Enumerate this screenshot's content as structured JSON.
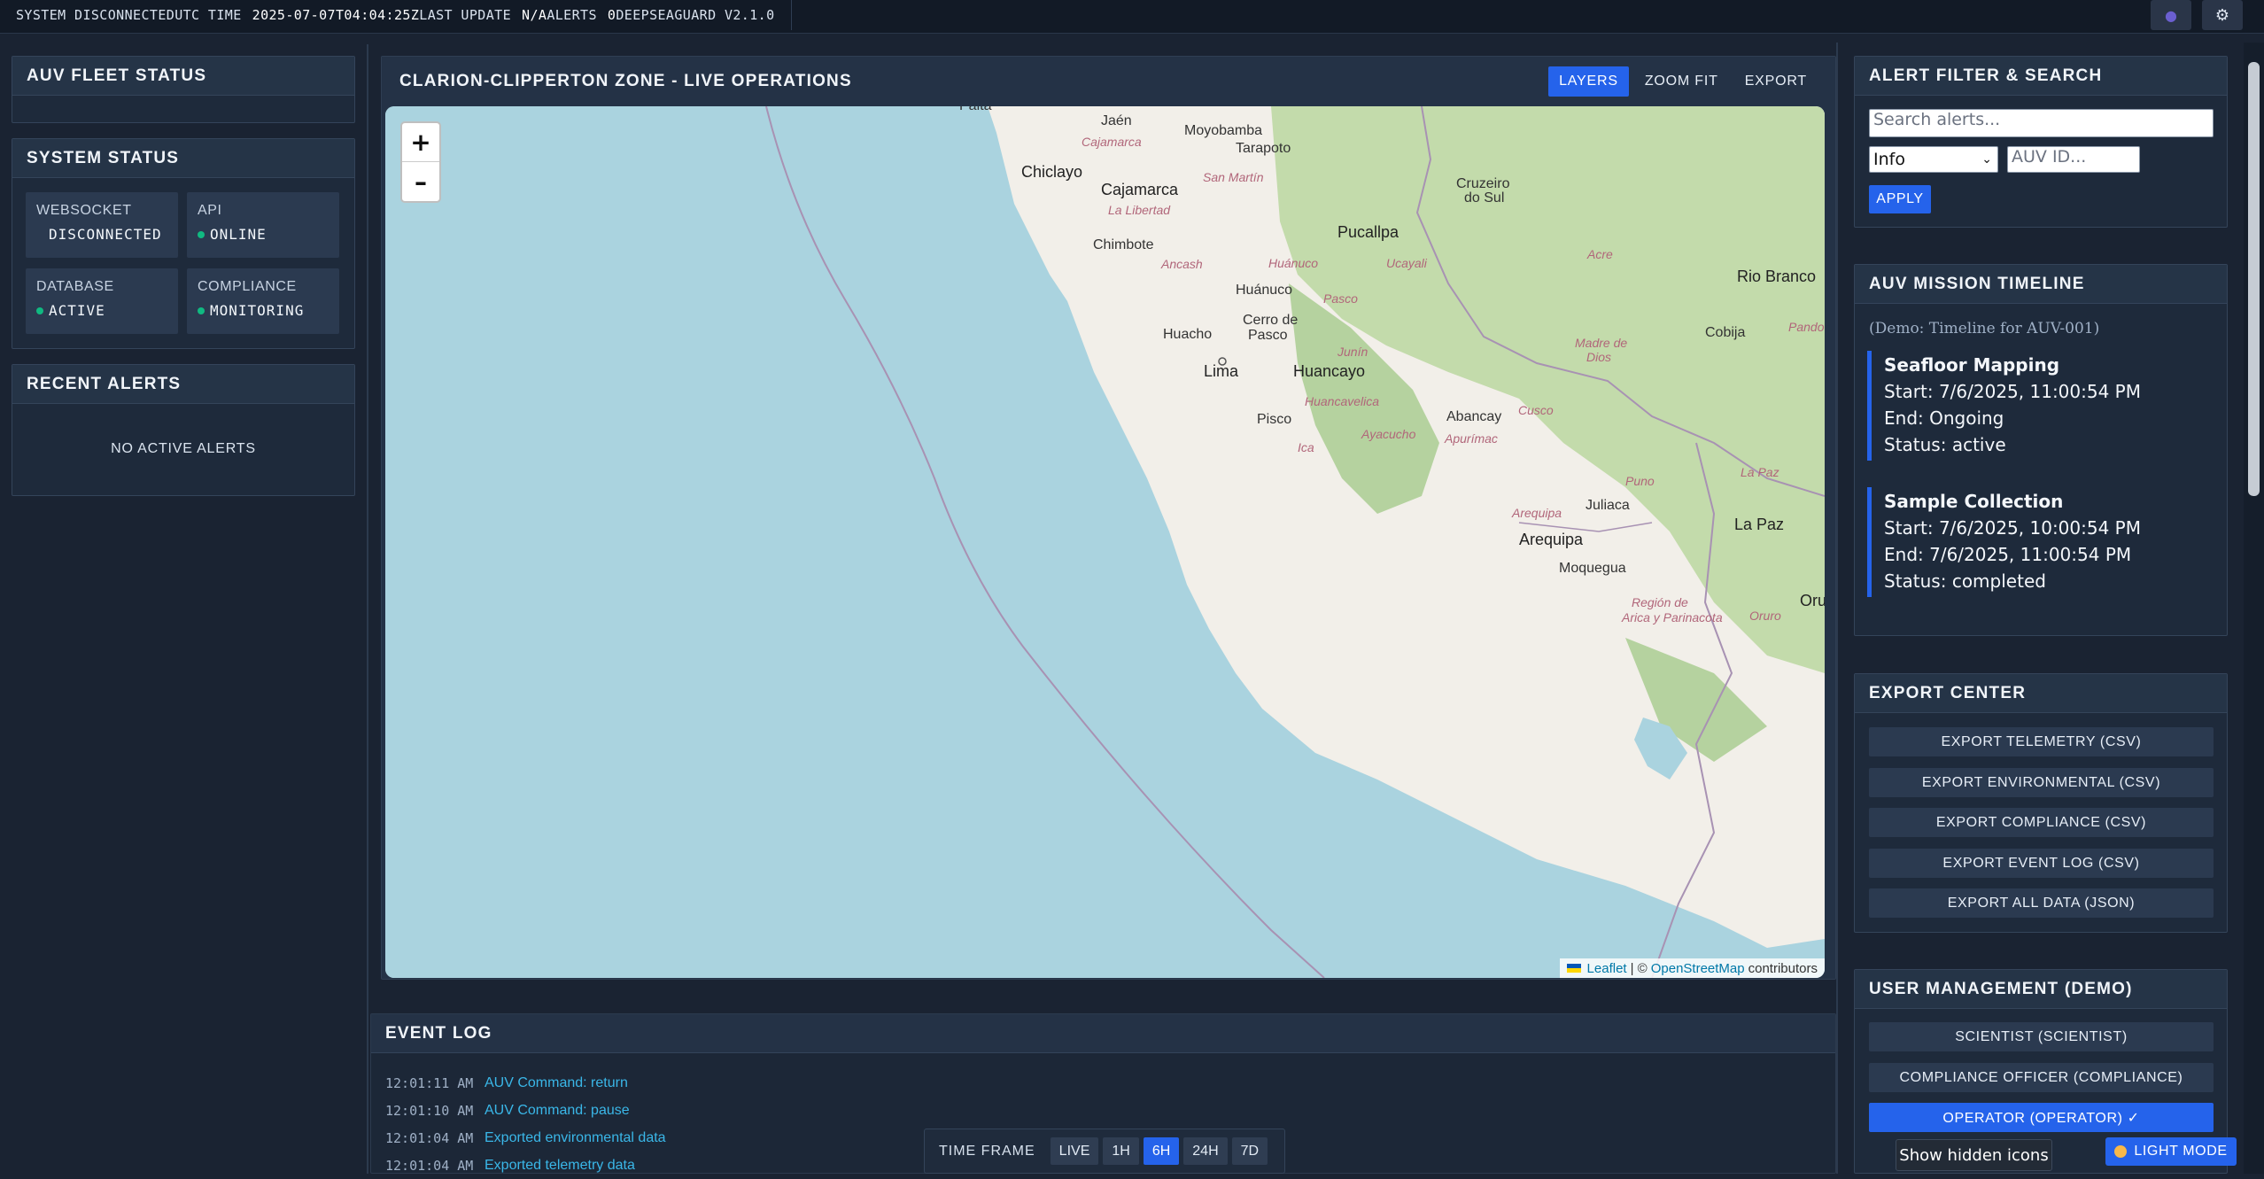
{
  "topbar": {
    "system_status": "SYSTEM DISCONNECTED",
    "utc_label": "UTC TIME",
    "utc_value": "2025-07-07T04:04:25Z",
    "last_update_label": "LAST UPDATE",
    "last_update_value": "N/A",
    "alerts_label": "ALERTS",
    "alerts_value": "0",
    "brand": "DEEPSEAGUARD V2.1.0"
  },
  "left": {
    "fleet_title": "AUV FLEET STATUS",
    "system_title": "SYSTEM STATUS",
    "status": [
      {
        "label": "WEBSOCKET",
        "value": "DISCONNECTED",
        "ok": false
      },
      {
        "label": "API",
        "value": "ONLINE",
        "ok": true
      },
      {
        "label": "DATABASE",
        "value": "ACTIVE",
        "ok": true
      },
      {
        "label": "COMPLIANCE",
        "value": "MONITORING",
        "ok": true
      }
    ],
    "alerts_title": "RECENT ALERTS",
    "no_alerts": "NO ACTIVE ALERTS"
  },
  "map": {
    "title": "CLARION-CLIPPERTON ZONE - LIVE OPERATIONS",
    "actions": [
      "LAYERS",
      "ZOOM FIT",
      "EXPORT"
    ],
    "zoom_in": "+",
    "zoom_out": "–",
    "attribution_leaflet": "Leaflet",
    "attribution_sep": "| ©",
    "attribution_osm": "OpenStreetMap",
    "attribution_tail": "contributors",
    "labels": {
      "cities_big": [
        "Chiclayo",
        "Cajamarca",
        "Pucallpa",
        "Lima",
        "Huancayo",
        "Arequipa",
        "La Paz",
        "Rio Branco"
      ],
      "cities_mid": [
        "Chimbote",
        "Huánuco",
        "Huacho",
        "Cerro de Pasco",
        "Pisco",
        "Abancay",
        "Juliaca",
        "Moquegua",
        "Cobija",
        "Cruzeiro do Sul",
        "Jaén",
        "Moyobamba",
        "Tarapoto",
        "Paita",
        "Oru"
      ],
      "regions": [
        "Cajamarca",
        "San Martín",
        "La Libertad",
        "Ancash",
        "Huánuco",
        "Ucayali",
        "Acre",
        "Pasco",
        "Junín",
        "Madre de Dios",
        "Pando",
        "Huancavelica",
        "Cusco",
        "Ayacucho",
        "Apurímac",
        "Ica",
        "Puno",
        "La Paz",
        "Arequipa",
        "Región de Arica y Parinacota",
        "Oruro"
      ]
    }
  },
  "events": {
    "title": "EVENT LOG",
    "items": [
      {
        "time": "12:01:11 AM",
        "msg": "AUV Command: return"
      },
      {
        "time": "12:01:10 AM",
        "msg": "AUV Command: pause"
      },
      {
        "time": "12:01:04 AM",
        "msg": "Exported environmental data"
      },
      {
        "time": "12:01:04 AM",
        "msg": "Exported telemetry data"
      }
    ]
  },
  "timeframe": {
    "label": "TIME FRAME",
    "options": [
      "LIVE",
      "1H",
      "6H",
      "24H",
      "7D"
    ],
    "selected": "6H"
  },
  "filter": {
    "title": "ALERT FILTER & SEARCH",
    "search_placeholder": "Search alerts...",
    "severity_selected": "Info",
    "auv_placeholder": "AUV ID...",
    "apply": "APPLY"
  },
  "timeline": {
    "title": "AUV MISSION TIMELINE",
    "note": "(Demo: Timeline for AUV-001)",
    "items": [
      {
        "title": "Seafloor Mapping",
        "start": "Start: 7/6/2025, 11:00:54 PM",
        "end": "End: Ongoing",
        "status": "Status: active"
      },
      {
        "title": "Sample Collection",
        "start": "Start: 7/6/2025, 10:00:54 PM",
        "end": "End: 7/6/2025, 11:00:54 PM",
        "status": "Status: completed"
      }
    ]
  },
  "export": {
    "title": "EXPORT CENTER",
    "buttons": [
      "EXPORT TELEMETRY (CSV)",
      "EXPORT ENVIRONMENTAL (CSV)",
      "EXPORT COMPLIANCE (CSV)",
      "EXPORT EVENT LOG (CSV)",
      "EXPORT ALL DATA (JSON)"
    ]
  },
  "users": {
    "title": "USER MANAGEMENT (DEMO)",
    "buttons": [
      "SCIENTIST (SCIENTIST)",
      "COMPLIANCE OFFICER (COMPLIANCE)",
      "OPERATOR (OPERATOR) ✓"
    ],
    "selected_index": 2
  },
  "tooltip": "Show hidden icons",
  "theme_toggle": "LIGHT MODE",
  "colors": {
    "accent": "#2563eb",
    "ok": "#10b981",
    "link": "#3ab7e8",
    "ocean": "#aad3df",
    "land": "#f2efe9",
    "forest": "#b5d29f"
  }
}
